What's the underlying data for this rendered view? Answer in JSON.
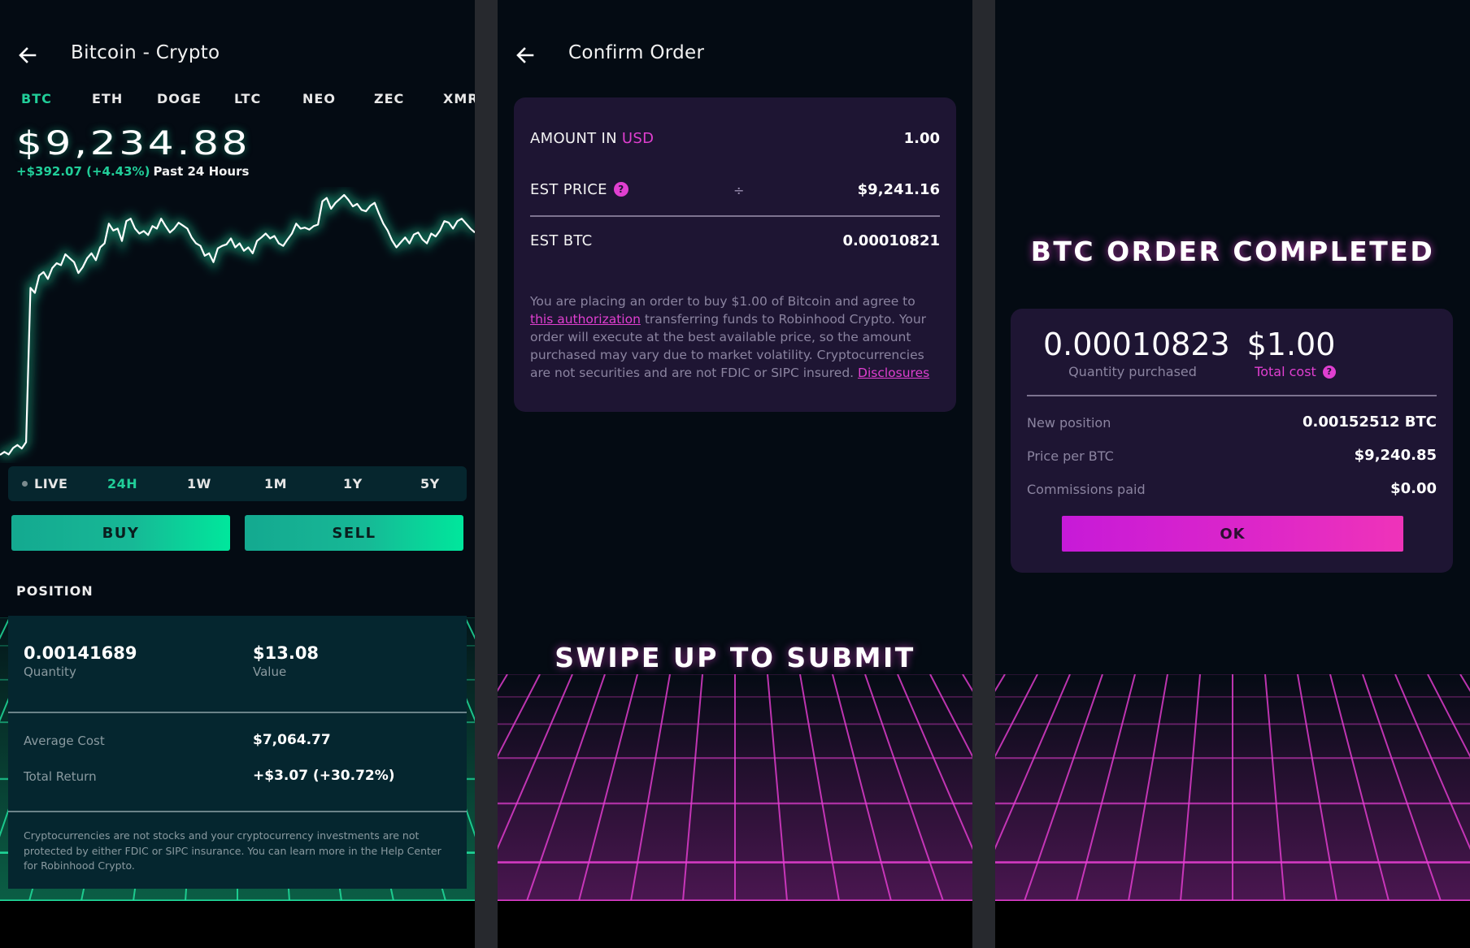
{
  "screen1": {
    "title": "Bitcoin - Crypto",
    "back_icon": "arrow-left-icon",
    "coin_tabs": [
      {
        "label": "BTC",
        "active": true
      },
      {
        "label": "ETH",
        "active": false
      },
      {
        "label": "DOGE",
        "active": false
      },
      {
        "label": "LTC",
        "active": false
      },
      {
        "label": "NEO",
        "active": false
      },
      {
        "label": "ZEC",
        "active": false
      },
      {
        "label": "XMR",
        "active": false
      }
    ],
    "price": "$9,234.88",
    "change": "+$392.07 (+4.43%)",
    "change_period": "Past 24 Hours",
    "chart": {
      "type": "line",
      "range": "24H",
      "line_color": "#ffffff",
      "glow_color": "#21ce99",
      "values": [
        8842,
        8848,
        8843,
        8856,
        8862,
        8855,
        8868,
        9180,
        9170,
        9205,
        9212,
        9198,
        9220,
        9230,
        9226,
        9248,
        9240,
        9232,
        9210,
        9222,
        9240,
        9250,
        9236,
        9262,
        9270,
        9310,
        9296,
        9300,
        9275,
        9315,
        9320,
        9300,
        9290,
        9295,
        9287,
        9305,
        9300,
        9320,
        9305,
        9292,
        9300,
        9312,
        9306,
        9300,
        9282,
        9270,
        9265,
        9245,
        9250,
        9232,
        9260,
        9265,
        9268,
        9280,
        9262,
        9270,
        9255,
        9262,
        9250,
        9275,
        9282,
        9290,
        9280,
        9285,
        9270,
        9265,
        9278,
        9290,
        9310,
        9300,
        9302,
        9298,
        9305,
        9308,
        9355,
        9362,
        9340,
        9352,
        9360,
        9368,
        9358,
        9345,
        9350,
        9338,
        9335,
        9346,
        9352,
        9330,
        9310,
        9296,
        9276,
        9262,
        9272,
        9282,
        9270,
        9288,
        9292,
        9278,
        9270,
        9290,
        9284,
        9296,
        9315,
        9312,
        9300,
        9315,
        9320,
        9310,
        9300,
        9292
      ]
    },
    "time_ranges": [
      {
        "label": "LIVE",
        "active": false
      },
      {
        "label": "24H",
        "active": true
      },
      {
        "label": "1W",
        "active": false
      },
      {
        "label": "1M",
        "active": false
      },
      {
        "label": "1Y",
        "active": false
      },
      {
        "label": "5Y",
        "active": false
      }
    ],
    "buy_label": "BUY",
    "sell_label": "SELL",
    "position": {
      "section_title": "POSITION",
      "quantity_value": "0.00141689",
      "quantity_label": "Quantity",
      "value_value": "$13.08",
      "value_label": "Value",
      "average_cost_label": "Average Cost",
      "average_cost_value": "$7,064.77",
      "total_return_label": "Total Return",
      "total_return_value": "+$3.07 (+30.72%)",
      "disclaimer": "Cryptocurrencies are not stocks and your cryptocurrency investments are not protected by either FDIC or SIPC insurance. You can learn more in the Help Center for Robinhood Crypto."
    }
  },
  "screen2": {
    "title": "Confirm Order",
    "back_icon": "arrow-left-icon",
    "amount_label_prefix": "AMOUNT IN ",
    "amount_label_currency": "USD",
    "amount_value": "1.00",
    "est_price_label": "EST PRICE",
    "help_icon_glyph": "?",
    "divide_glyph": "÷",
    "est_price_value": "$9,241.16",
    "est_btc_label": "EST BTC",
    "est_btc_value": "0.00010821",
    "disclaimer_part1": "You are placing an order to buy $1.00 of Bitcoin and agree to ",
    "disclaimer_link1": "this authorization",
    "disclaimer_part2": " transferring funds to Robinhood Crypto. Your order will execute at the best available price, so the amount purchased may vary due to market volatility. Cryptocurrencies are not securities and are not FDIC or SIPC insured. ",
    "disclaimer_link2": "Disclosures",
    "swipe_text": "SWIPE UP TO SUBMIT"
  },
  "screen3": {
    "title": "BTC ORDER COMPLETED",
    "quantity_value": "0.00010823",
    "quantity_label": "Quantity purchased",
    "cost_value": "$1.00",
    "cost_label": "Total cost",
    "help_icon_glyph": "?",
    "rows": [
      {
        "label": "New position",
        "value": "0.00152512 BTC"
      },
      {
        "label": "Price per BTC",
        "value": "$9,240.85"
      },
      {
        "label": "Commissions paid",
        "value": "$0.00"
      }
    ],
    "ok_label": "OK"
  },
  "colors": {
    "green_accent": "#21ce99",
    "pink_accent": "#e03fd0",
    "background": "#040b13",
    "card_dark_teal": "#05262f",
    "card_purple": "#1e1533"
  }
}
